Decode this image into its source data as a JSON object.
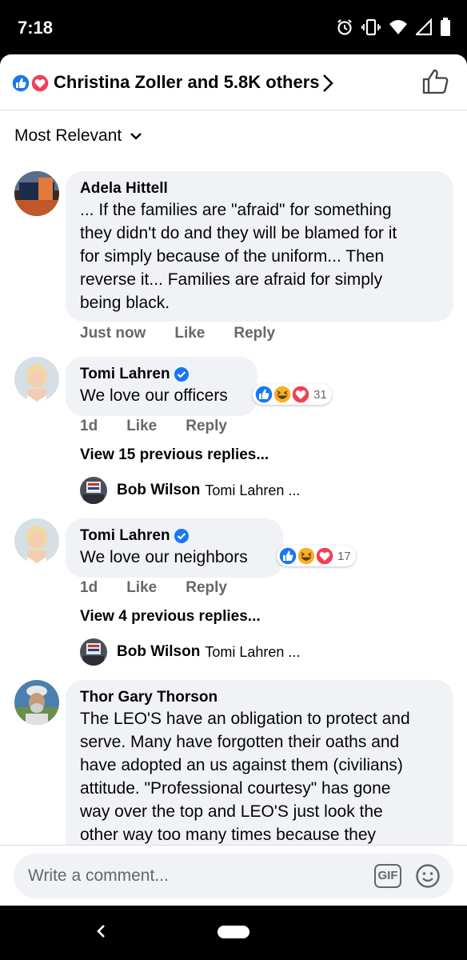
{
  "status_bar": {
    "time": "7:18",
    "icons": [
      "alarm-icon",
      "vibrate-icon",
      "wifi-icon",
      "signal-icon",
      "battery-icon"
    ]
  },
  "reactions_header": {
    "text": "Christina Zoller and 5.8K others",
    "reaction_icons": [
      "like-reaction-icon",
      "love-reaction-icon"
    ]
  },
  "sort": {
    "label": "Most Relevant"
  },
  "comments": [
    {
      "author": "Adela Hittell",
      "verified": false,
      "text": "... If the families are \"afraid\" for something they didn't do and they will be blamed for it for simply because of  the uniform... Then reverse it... Families are afraid for simply being black.",
      "lines": [
        "... If the families are \"afraid\" for something",
        "they didn't do and they will be blamed for it",
        "for simply because of  the uniform... Then",
        "reverse it... Families are afraid for simply",
        "being black."
      ],
      "time": "Just now",
      "like_label": "Like",
      "reply_label": "Reply"
    },
    {
      "author": "Tomi Lahren",
      "verified": true,
      "text": "We love our officers",
      "reactions": [
        "like",
        "haha",
        "love"
      ],
      "reaction_count": "31",
      "time": "1d",
      "like_label": "Like",
      "reply_label": "Reply",
      "view_replies": "View 15 previous replies...",
      "latest_reply": {
        "author": "Bob Wilson",
        "snippet": "Tomi Lahren ..."
      }
    },
    {
      "author": "Tomi Lahren",
      "verified": true,
      "text": "We love our neighbors",
      "reactions": [
        "like",
        "haha",
        "love"
      ],
      "reaction_count": "17",
      "time": "1d",
      "like_label": "Like",
      "reply_label": "Reply",
      "view_replies": "View 4 previous replies...",
      "latest_reply": {
        "author": "Bob Wilson",
        "snippet": "Tomi Lahren ..."
      }
    },
    {
      "author": "Thor Gary Thorson",
      "verified": false,
      "text": "The LEO'S have an obligation to protect and serve. Many have forgotten their oaths and have adopted an us against them (civilians) attitude. \"Professional courtesy\" has gone way over the top and LEO'S  just look the other way too many times because they",
      "lines": [
        "The LEO'S have an obligation to protect and",
        "serve. Many have forgotten their oaths and",
        "have adopted an us against them (civilians)",
        "attitude. \"Professional courtesy\" has gone",
        "way over the top and LEO'S  just look the",
        "other way too many times because they"
      ]
    }
  ],
  "composer": {
    "placeholder": "Write a comment...",
    "gif_label": "GIF"
  },
  "colors": {
    "like_blue": "#1877f2",
    "love_red": "#f33e58",
    "haha_yellow": "#f7b125",
    "bubble_bg": "#f0f2f5",
    "secondary_text": "#65676b"
  }
}
